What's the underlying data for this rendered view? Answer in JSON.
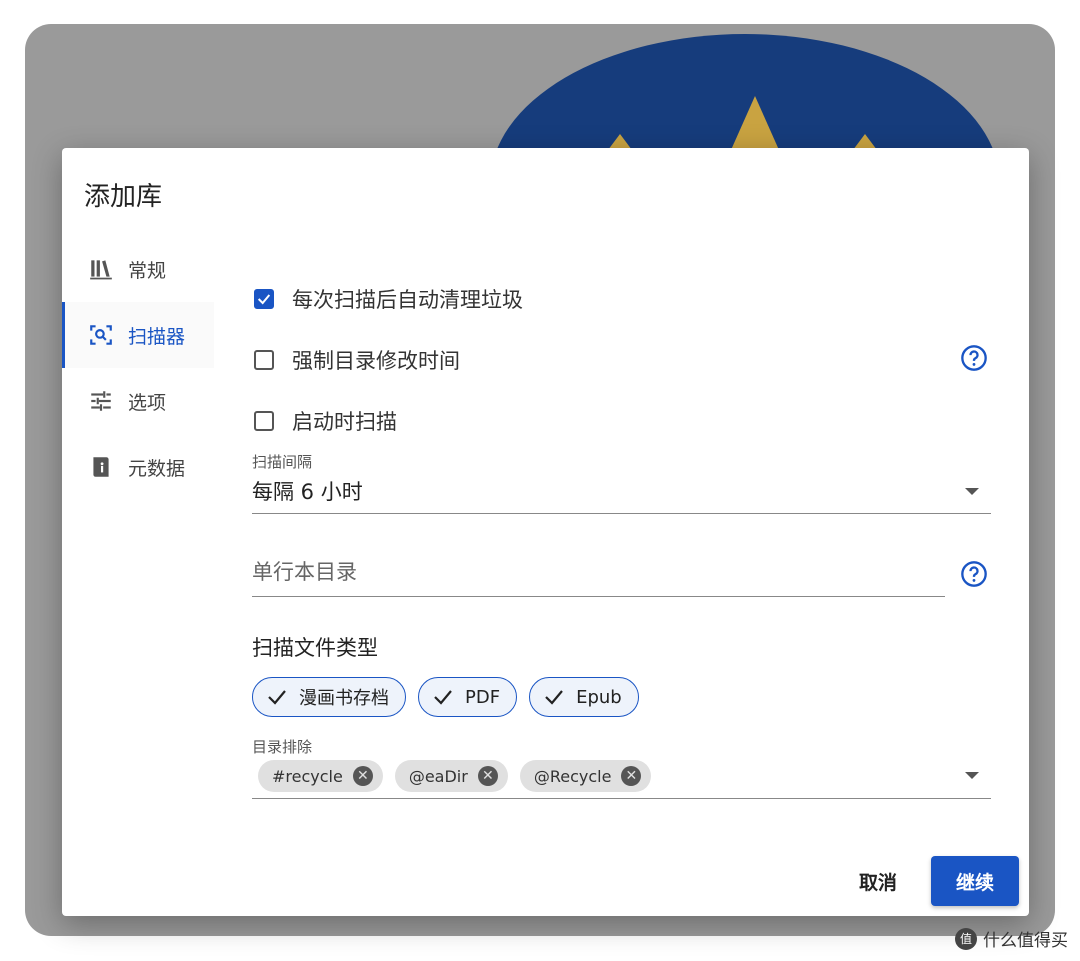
{
  "dialog": {
    "title": "添加库"
  },
  "nav": {
    "items": [
      {
        "label": "常规",
        "icon": "library-icon",
        "active": false
      },
      {
        "label": "扫描器",
        "icon": "scan-search-icon",
        "active": true
      },
      {
        "label": "选项",
        "icon": "tune-icon",
        "active": false
      },
      {
        "label": "元数据",
        "icon": "book-info-icon",
        "active": false
      }
    ]
  },
  "scanner": {
    "options": [
      {
        "label": "每次扫描后自动清理垃圾",
        "checked": true,
        "help": false
      },
      {
        "label": "强制目录修改时间",
        "checked": false,
        "help": true
      },
      {
        "label": "启动时扫描",
        "checked": false,
        "help": false
      }
    ],
    "interval": {
      "label": "扫描间隔",
      "value": "每隔 6 小时"
    },
    "oneshots": {
      "placeholder": "单行本目录"
    },
    "file_types": {
      "title": "扫描文件类型",
      "chips": [
        "漫画书存档",
        "PDF",
        "Epub"
      ]
    },
    "exclusions": {
      "label": "目录排除",
      "tags": [
        "#recycle",
        "@eaDir",
        "@Recycle"
      ]
    }
  },
  "actions": {
    "cancel": "取消",
    "continue": "继续"
  },
  "watermark": {
    "logo_glyph": "值",
    "text": "什么值得买"
  },
  "colors": {
    "primary": "#1a55c4",
    "backdrop": "#9a9a9a"
  }
}
